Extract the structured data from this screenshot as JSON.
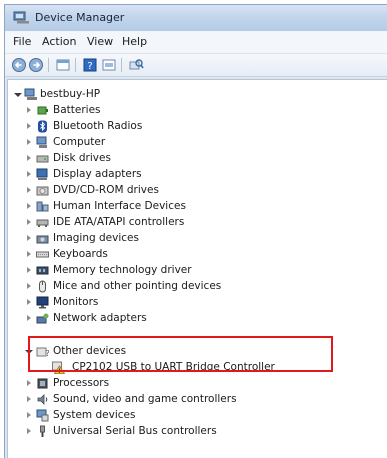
{
  "window": {
    "title": "Device Manager"
  },
  "menu": {
    "items": [
      "File",
      "Action",
      "View",
      "Help"
    ]
  },
  "toolbar": {
    "buttons": [
      "back-icon",
      "forward-icon",
      "properties-icon",
      "help-icon",
      "update-icon",
      "scan-hardware-icon"
    ]
  },
  "tree": {
    "root": "bestbuy-HP",
    "categories": [
      "Batteries",
      "Bluetooth Radios",
      "Computer",
      "Disk drives",
      "Display adapters",
      "DVD/CD-ROM drives",
      "Human Interface Devices",
      "IDE ATA/ATAPI controllers",
      "Imaging devices",
      "Keyboards",
      "Memory technology driver",
      "Mice and other pointing devices",
      "Monitors",
      "Network adapters",
      "Other devices",
      "Processors",
      "Sound, video and game controllers",
      "System devices",
      "Universal Serial Bus controllers"
    ],
    "other_device_child": "CP2102 USB to UART Bridge Controller"
  },
  "colors": {
    "highlight": "#e0191f",
    "warning": "#f2c12e"
  }
}
